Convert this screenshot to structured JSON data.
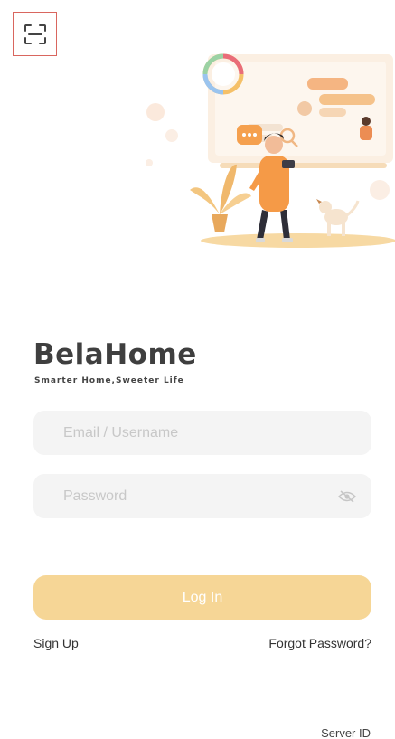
{
  "brand": {
    "name": "BelaHome",
    "tagline": "Smarter Home,Sweeter Life"
  },
  "form": {
    "email_placeholder": "Email / Username",
    "password_placeholder": "Password",
    "login_label": "Log In"
  },
  "links": {
    "sign_up": "Sign Up",
    "forgot_password": "Forgot Password?",
    "server_id": "Server ID"
  },
  "colors": {
    "accent": "#f6d696",
    "field_bg": "#f4f4f4",
    "scan_border": "#d9665f"
  },
  "icons": {
    "scan": "scan-qr-icon",
    "password_toggle": "eye-slash-icon"
  }
}
